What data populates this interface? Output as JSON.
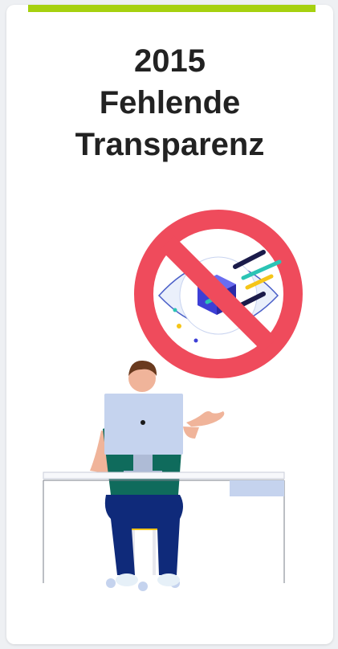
{
  "card": {
    "title_lines": [
      "2015",
      "Fehlende",
      "Transparenz"
    ]
  },
  "colors": {
    "accent": "#a6d10f",
    "prohibition_red": "#ef4b5c",
    "shirt": "#0f6b5c",
    "pants": "#0f2a7a",
    "chair": "#f5c518",
    "monitor": "#c5d3ee"
  },
  "illustration": {
    "icons": [
      "prohibition-sign-icon",
      "eye-icon",
      "data-cube-icon",
      "person-at-desk-illustration",
      "monitor-icon"
    ]
  }
}
